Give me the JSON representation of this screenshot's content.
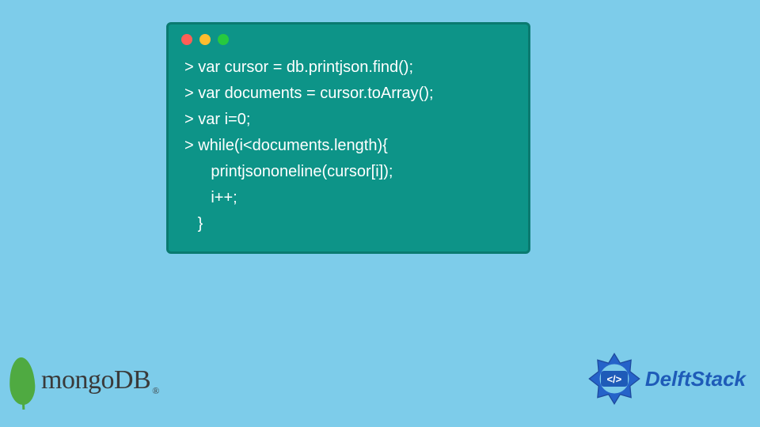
{
  "terminal": {
    "lines": [
      "> var cursor = db.printjson.find();",
      "> var documents = cursor.toArray();",
      "> var i=0;",
      "> while(i<documents.length){",
      "      printjsononeline(cursor[i]);",
      "      i++;",
      "   }"
    ]
  },
  "mongo": {
    "label": "mongoDB",
    "registered": "®"
  },
  "delftstack": {
    "code_symbol": "</>",
    "label": "DelftStack"
  }
}
